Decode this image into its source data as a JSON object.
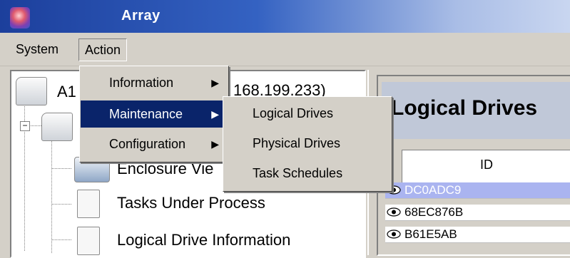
{
  "window": {
    "title": "Array"
  },
  "menubar": {
    "system_label": "System",
    "action_label": "Action"
  },
  "tree": {
    "root_label_prefix": "A1",
    "root_label_suffix": "168.199.233)",
    "items": [
      {
        "label": "Enclosure Vie"
      },
      {
        "label": "Tasks Under Process"
      },
      {
        "label": "Logical Drive Information"
      }
    ]
  },
  "content": {
    "title": "Logical Drives",
    "table": {
      "column_header": "ID",
      "rows": [
        {
          "id": "DC0ADC9",
          "selected": true
        },
        {
          "id": "68EC876B",
          "selected": false
        },
        {
          "id": "B61E5AB",
          "selected": false
        }
      ]
    }
  },
  "action_menu": {
    "items": [
      {
        "label": "Information",
        "submenu": true,
        "active": false
      },
      {
        "label": "Maintenance",
        "submenu": true,
        "active": true
      },
      {
        "label": "Configuration",
        "submenu": true,
        "active": false
      }
    ],
    "arrow_glyph": "▶"
  },
  "maintenance_submenu": {
    "items": [
      {
        "label": "Logical Drives"
      },
      {
        "label": "Physical Drives"
      },
      {
        "label": "Task Schedules"
      }
    ]
  },
  "colors": {
    "selection_highlight": "#0a246a",
    "row_selected": "#aab4f0",
    "titlebar_start": "#1c3f9c"
  }
}
